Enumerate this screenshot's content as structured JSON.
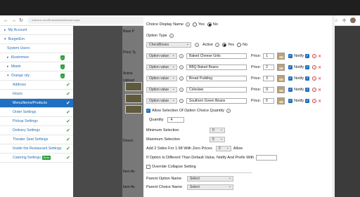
{
  "browser": {
    "url": "onlinem.com/BusinessDashboard.aspx",
    "icons": [
      "share-icon",
      "star-icon",
      "extensions-icon",
      "profile-icon"
    ]
  },
  "sidebar": {
    "items": [
      {
        "label": "My Account",
        "prefix": "▸",
        "status": ""
      },
      {
        "label": "BurgerEm",
        "prefix": "▾",
        "status": ""
      },
      {
        "label": "System Users",
        "prefix": "",
        "status": ""
      },
      {
        "label": "Kissimmee",
        "prefix": "▸",
        "status": "shield"
      },
      {
        "label": "Miami",
        "prefix": "▸",
        "status": "shield"
      },
      {
        "label": "Orange city",
        "prefix": "▾",
        "status": "shield"
      },
      {
        "label": "Address",
        "prefix": "",
        "status": "check"
      },
      {
        "label": "Hours",
        "prefix": "",
        "status": "check"
      },
      {
        "label": "Menu/Items/Products",
        "prefix": "",
        "status": "check",
        "active": true
      },
      {
        "label": "Order Settings",
        "prefix": "",
        "status": "check"
      },
      {
        "label": "Pickup Settings",
        "prefix": "",
        "status": "check"
      },
      {
        "label": "Delivery Settings",
        "prefix": "",
        "status": "check"
      },
      {
        "label": "Theater Seat Settings",
        "prefix": "",
        "status": "check"
      },
      {
        "label": "Inside the Restaurant Settings",
        "prefix": "",
        "status": "check"
      },
      {
        "label": "Catering Settings",
        "prefix": "",
        "status": "check",
        "badge": "Beta"
      }
    ]
  },
  "behind": {
    "labels": [
      "Base P",
      "Price Ty",
      "Active",
      "Upload",
      "Descri",
      "Item Av",
      "Item Av"
    ]
  },
  "modal": {
    "top_cut_label": "Choice Display Name",
    "top_radio_yes": "Yes",
    "top_radio_no": "No",
    "option_type_label": "Option Type",
    "option_type_value": "CheckBoxes",
    "active_label": "Active",
    "active_yes": "Yes",
    "active_no": "No",
    "options": [
      {
        "value": "Option value",
        "name": "Baked Cheese Grits",
        "price": "1"
      },
      {
        "value": "Option value",
        "name": "BBQ Baked Beans",
        "price": "2"
      },
      {
        "value": "Option value",
        "name": "Bread Pudding",
        "price": "3"
      },
      {
        "value": "Option value",
        "name": "Coleslaw",
        "price": "9"
      },
      {
        "value": "Option value",
        "name": "Southern Green Beans",
        "price": "5"
      }
    ],
    "price_label": "Price:",
    "notify_label": "Notify",
    "allow_quantity_label": "Allow Selection Of Option Choice Quantity",
    "quantity_label": "Quantity",
    "quantity_value": "4",
    "min_label": "Minimum Selection",
    "min_value": "0",
    "max_label": "Maximum Selection",
    "max_value": "5",
    "add_sides_label": "Add 2 Sides For 1.98 With Zero Prices",
    "add_sides_value": "0",
    "allow_label": "Allow",
    "if_option_label": "If Option Is Different Than Default Value, Notify And Prefix With",
    "override_label": "Override Collapse Setting",
    "parent_option_label": "Parent Option Name",
    "parent_option_value": "Select",
    "parent_choice_label": "Parent Choice Name",
    "parent_choice_value": "Select"
  },
  "colors": {
    "accent": "#1f6fc2",
    "ok": "#2e9e3e",
    "remove": "#dd2233"
  }
}
